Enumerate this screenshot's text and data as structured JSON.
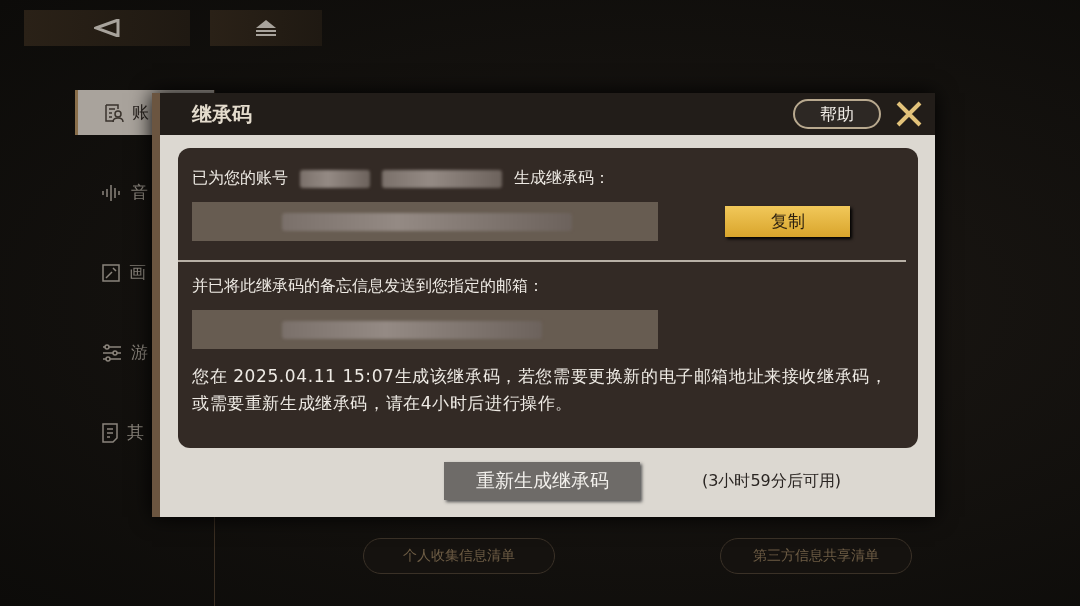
{
  "top_bar": {
    "buttons": [
      {
        "kind": "back"
      },
      {
        "kind": "eject"
      }
    ]
  },
  "sidebar": {
    "items": [
      {
        "label": "账",
        "kind": "account",
        "selected": true
      },
      {
        "label": "音",
        "kind": "sound",
        "selected": false
      },
      {
        "label": "画",
        "kind": "display",
        "selected": false
      },
      {
        "label": "游",
        "kind": "game",
        "selected": false
      },
      {
        "label": "其",
        "kind": "other",
        "selected": false
      }
    ]
  },
  "footer_buttons": [
    "个人收集信息清单",
    "第三方信息共享清单"
  ],
  "dialog": {
    "title": "继承码",
    "help": "帮助",
    "account_line": {
      "before": "已为您的账号",
      "after": "生成继承码："
    },
    "copy_button": "复制",
    "email_line": "并已将此继承码的备忘信息发送到您指定的邮箱：",
    "note": "您在 2025.04.11 15:07生成该继承码，若您需要更换新的电子邮箱地址来接收继承码，或需要重新生成继承码，请在4小时后进行操作。",
    "regenerate_button": {
      "label": "重新生成继承码",
      "disabled": true
    },
    "countdown": "(3小时59分后可用)"
  }
}
